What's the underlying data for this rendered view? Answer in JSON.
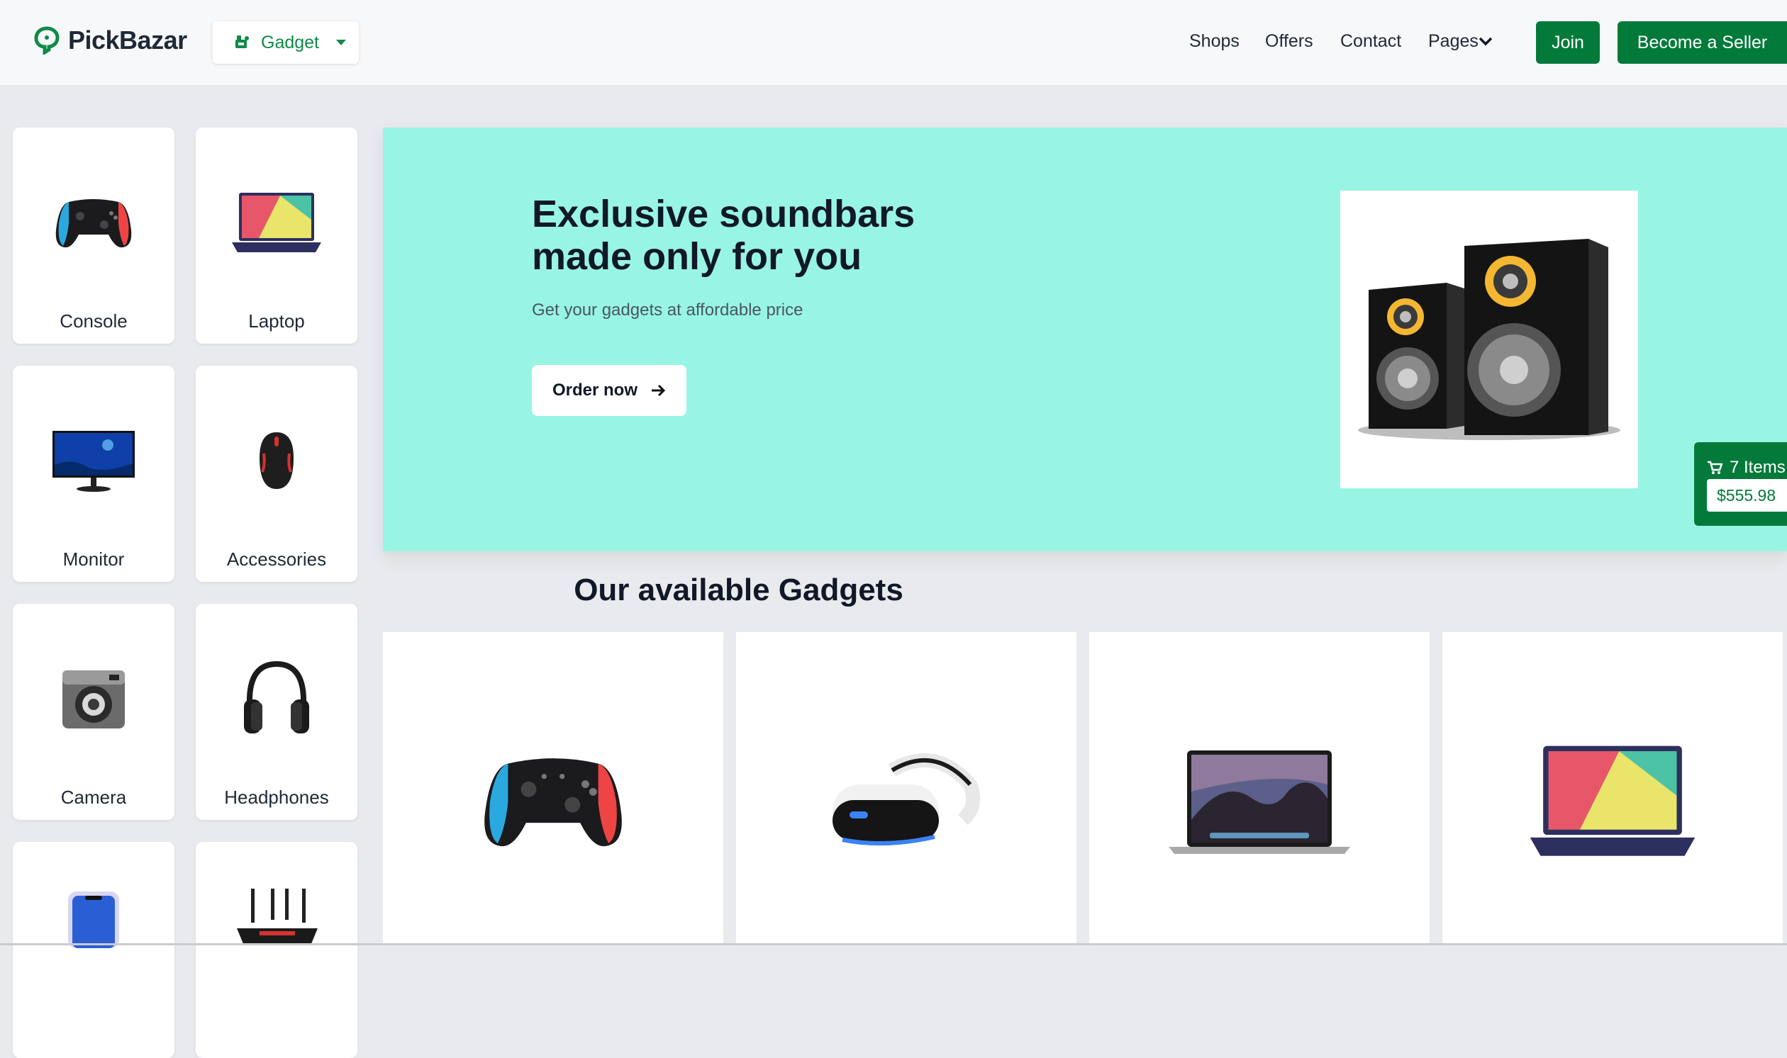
{
  "header": {
    "brand": "PickBazar",
    "shop_type": "Gadget",
    "nav": [
      "Shops",
      "Offers",
      "Contact",
      "Pages"
    ],
    "join_label": "Join",
    "seller_label": "Become a Seller",
    "accent_color": "#037a3a"
  },
  "categories": [
    {
      "label": "Console",
      "icon": "gamepad-icon"
    },
    {
      "label": "Laptop",
      "icon": "laptop-icon"
    },
    {
      "label": "Monitor",
      "icon": "monitor-icon"
    },
    {
      "label": "Accessories",
      "icon": "mouse-icon"
    },
    {
      "label": "Camera",
      "icon": "camera-icon"
    },
    {
      "label": "Headphones",
      "icon": "headphones-icon"
    },
    {
      "label": "",
      "icon": "phone-icon"
    },
    {
      "label": "",
      "icon": "router-icon"
    }
  ],
  "banner": {
    "title_line1": "Exclusive soundbars",
    "title_line2": "made only for you",
    "subtitle": "Get your gadgets at affordable price",
    "cta": "Order now",
    "background": "#98f5e3"
  },
  "cart": {
    "items_label": "7 Items",
    "total": "$555.98"
  },
  "section": {
    "title": "Our available Gadgets"
  },
  "products": [
    {
      "icon": "gamepad-icon"
    },
    {
      "icon": "vr-headset-icon"
    },
    {
      "icon": "macbook-icon"
    },
    {
      "icon": "laptop-icon"
    }
  ]
}
